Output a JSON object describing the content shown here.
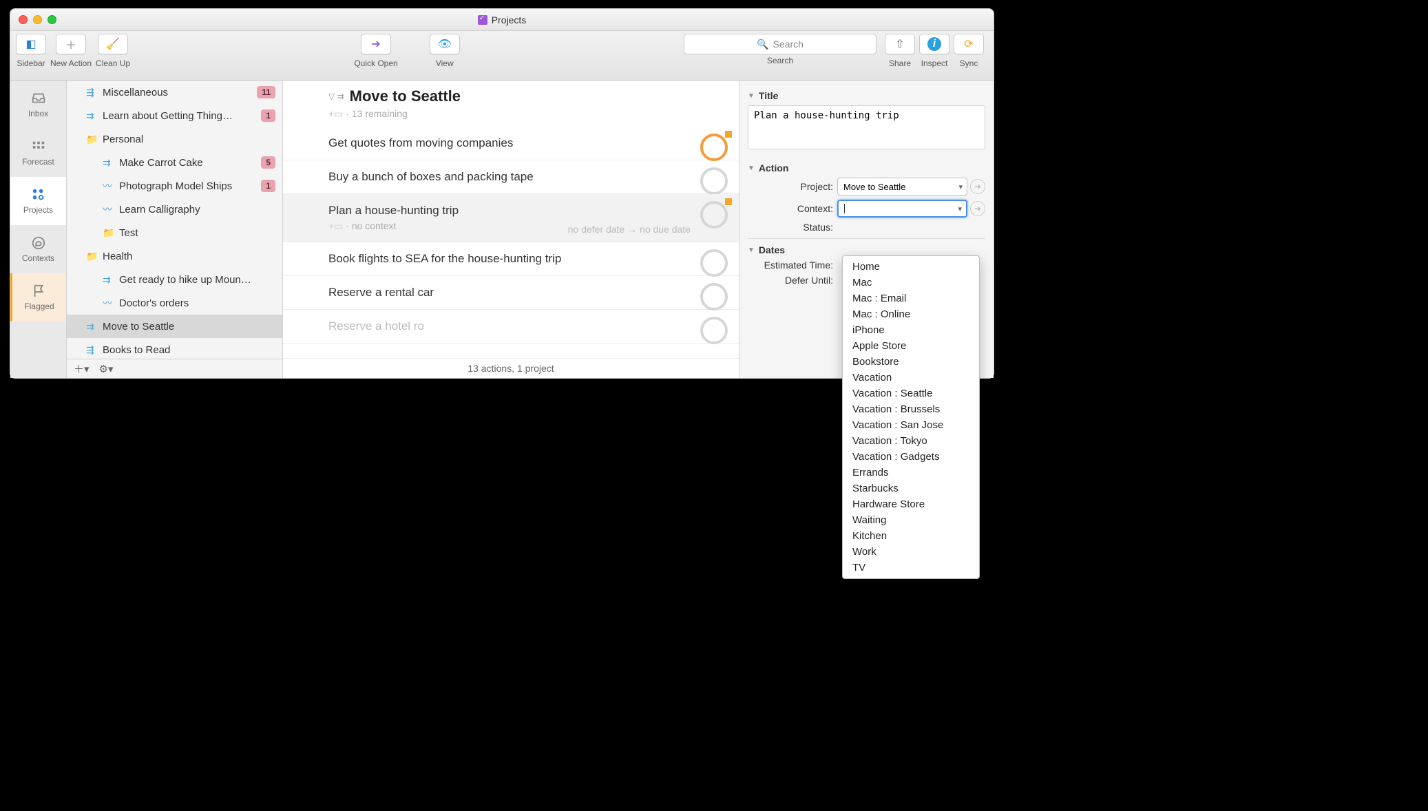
{
  "window": {
    "title": "Projects"
  },
  "toolbar": {
    "sidebar": "Sidebar",
    "new_action": "New Action",
    "clean_up": "Clean Up",
    "quick_open": "Quick Open",
    "view": "View",
    "search_label": "Search",
    "search_placeholder": "Search",
    "share": "Share",
    "inspect": "Inspect",
    "sync": "Sync"
  },
  "perspectives": {
    "inbox": "Inbox",
    "forecast": "Forecast",
    "projects": "Projects",
    "contexts": "Contexts",
    "flagged": "Flagged"
  },
  "projects": [
    {
      "name": "Miscellaneous",
      "icon": "parallel",
      "indent": 1,
      "badge": "11"
    },
    {
      "name": "Learn about Getting Thing…",
      "icon": "sequential",
      "indent": 1,
      "badge": "1"
    },
    {
      "name": "Personal",
      "icon": "folder",
      "indent": 1
    },
    {
      "name": "Make Carrot Cake",
      "icon": "sequential",
      "indent": 2,
      "badge": "5"
    },
    {
      "name": "Photograph Model Ships",
      "icon": "single",
      "indent": 2,
      "badge": "1"
    },
    {
      "name": "Learn Calligraphy",
      "icon": "single",
      "indent": 2
    },
    {
      "name": "Test",
      "icon": "folder",
      "indent": 2
    },
    {
      "name": "Health",
      "icon": "folder",
      "indent": 1
    },
    {
      "name": "Get ready to hike up Moun…",
      "icon": "sequential",
      "indent": 2
    },
    {
      "name": "Doctor's orders",
      "icon": "single",
      "indent": 2
    },
    {
      "name": "Move to Seattle",
      "icon": "sequential",
      "indent": 1,
      "selected": true
    },
    {
      "name": "Books to Read",
      "icon": "parallel",
      "indent": 1
    }
  ],
  "main": {
    "title": "Move to Seattle",
    "subtitle": "13 remaining",
    "tasks": [
      {
        "title": "Get quotes from moving companies",
        "orange": true,
        "flagged": true
      },
      {
        "title": "Buy a bunch of boxes and packing tape"
      },
      {
        "title": "Plan a house-hunting trip",
        "selected": true,
        "sub": "no context",
        "defer": "no defer date",
        "due": "no due date",
        "flagged": true
      },
      {
        "title": "Book flights to SEA for the house-hunting trip"
      },
      {
        "title": "Reserve a rental car"
      },
      {
        "title": "Reserve a hotel ro",
        "dimmed": true
      }
    ],
    "status": "13 actions, 1 project"
  },
  "inspector": {
    "title_section": "Title",
    "title_value": "Plan a house-hunting trip",
    "action_section": "Action",
    "project_label": "Project:",
    "project_value": "Move to Seattle",
    "context_label": "Context:",
    "context_value": "",
    "status_label": "Status:",
    "dates_section": "Dates",
    "estimated_label": "Estimated Time:",
    "defer_label": "Defer Until:"
  },
  "context_menu": [
    "Home",
    "Mac",
    "Mac : Email",
    "Mac : Online",
    "iPhone",
    "Apple Store",
    "Bookstore",
    "Vacation",
    "Vacation : Seattle",
    "Vacation : Brussels",
    "Vacation : San Jose",
    "Vacation : Tokyo",
    "Vacation : Gadgets",
    "Errands",
    "Starbucks",
    "Hardware Store",
    "Waiting",
    "Kitchen",
    "Work",
    "TV"
  ],
  "sub_prefix": "+▭ ·"
}
